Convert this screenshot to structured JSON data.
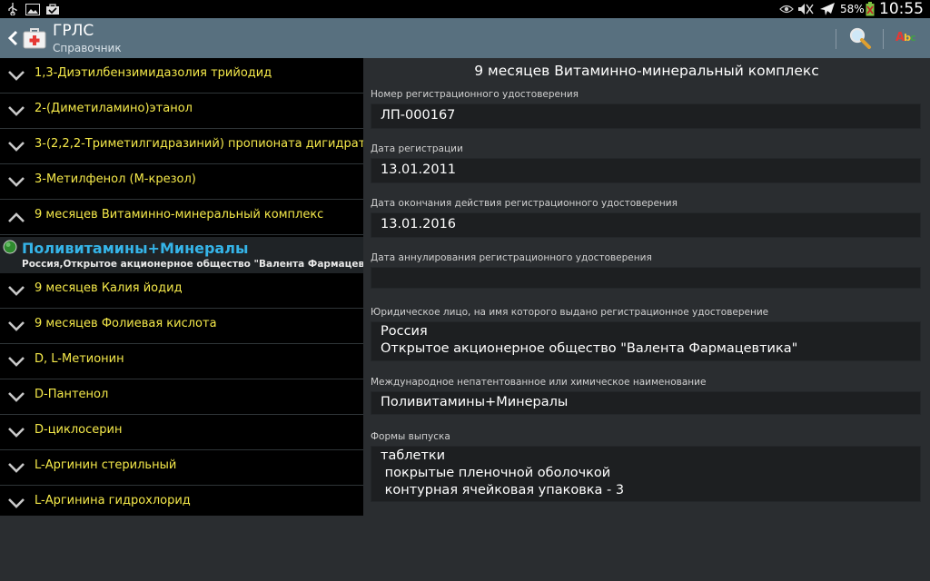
{
  "statusbar": {
    "icons_left": [
      "usb-icon",
      "image-icon",
      "check-bag-icon"
    ],
    "icons_right": [
      "eye-icon",
      "mute-icon",
      "airplane-icon"
    ],
    "battery_percent": "58%",
    "time": "10:55"
  },
  "actionbar": {
    "title": "ГРЛС",
    "subtitle": "Справочник",
    "abc_label": "Abc"
  },
  "list": {
    "items": [
      {
        "label": "1,3-Диэтилбензимидазолия трийодид",
        "expanded": false
      },
      {
        "label": "2-(Диметиламино)этанол",
        "expanded": false
      },
      {
        "label": "3-(2,2,2-Триметилгидразиний) пропионата дигидрат",
        "expanded": false
      },
      {
        "label": "3-Метилфенол (М-крезол)",
        "expanded": false
      },
      {
        "label": "9 месяцев Витаминно-минеральный комплекс",
        "expanded": true
      },
      {
        "label": "9 месяцев Калия йодид",
        "expanded": false
      },
      {
        "label": "9 месяцев Фолиевая кислота",
        "expanded": false
      },
      {
        "label": "D, L-Метионин",
        "expanded": false
      },
      {
        "label": "D-Пантенол",
        "expanded": false
      },
      {
        "label": "D-циклосерин",
        "expanded": false
      },
      {
        "label": "L-Аргинин стерильный",
        "expanded": false
      },
      {
        "label": "L-Аргинина гидрохлорид",
        "expanded": false
      }
    ],
    "subitem": {
      "name": "Поливитамины+Минералы",
      "maker": "Россия,Открытое акционерное общество \"Валента Фармацевтика\""
    }
  },
  "detail": {
    "title": "9 месяцев Витаминно-минеральный комплекс",
    "fields": [
      {
        "label": "Номер регистрационного удостоверения",
        "lines": [
          "ЛП-000167"
        ]
      },
      {
        "label": "Дата регистрации",
        "lines": [
          "13.01.2011"
        ]
      },
      {
        "label": "Дата окончания действия регистрационного удостоверения",
        "lines": [
          "13.01.2016"
        ]
      },
      {
        "label": "Дата аннулирования регистрационного удостоверения",
        "lines": [
          ""
        ]
      },
      {
        "label": "Юридическое лицо, на имя которого выдано регистрационное удостоверение",
        "lines": [
          "Россия",
          "Открытое акционерное общество \"Валента Фармацевтика\""
        ]
      },
      {
        "label": "Международное непатентованное или химическое наименование",
        "lines": [
          "Поливитамины+Минералы"
        ]
      },
      {
        "label": "Формы выпуска",
        "lines": [
          "таблетки",
          " покрытые пленочной оболочкой",
          " контурная ячейковая упаковка - 3"
        ]
      }
    ]
  },
  "colors": {
    "actionbar": "#58707f",
    "list_text": "#f5e94a",
    "subitem_name": "#35b4e8"
  }
}
